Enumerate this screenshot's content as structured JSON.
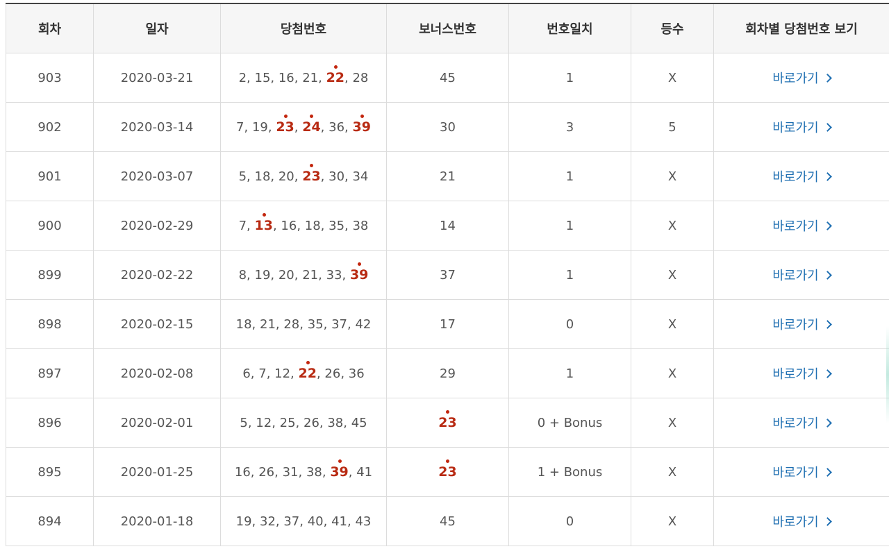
{
  "headers": [
    "회차",
    "일자",
    "당첨번호",
    "보너스번호",
    "번호일치",
    "등수",
    "회차별 당첨번호 보기"
  ],
  "link_label": "바로가기",
  "hit_color": "#b82a12",
  "link_color": "#1f6fb2",
  "rows": [
    {
      "round": "903",
      "date": "2020-03-21",
      "numbers": [
        "2",
        "15",
        "16",
        "21",
        "22",
        "28"
      ],
      "hits": [
        4
      ],
      "bonus": "45",
      "bonus_hit": false,
      "match": "1",
      "rank": "X"
    },
    {
      "round": "902",
      "date": "2020-03-14",
      "numbers": [
        "7",
        "19",
        "23",
        "24",
        "36",
        "39"
      ],
      "hits": [
        2,
        3,
        5
      ],
      "bonus": "30",
      "bonus_hit": false,
      "match": "3",
      "rank": "5"
    },
    {
      "round": "901",
      "date": "2020-03-07",
      "numbers": [
        "5",
        "18",
        "20",
        "23",
        "30",
        "34"
      ],
      "hits": [
        3
      ],
      "bonus": "21",
      "bonus_hit": false,
      "match": "1",
      "rank": "X"
    },
    {
      "round": "900",
      "date": "2020-02-29",
      "numbers": [
        "7",
        "13",
        "16",
        "18",
        "35",
        "38"
      ],
      "hits": [
        1
      ],
      "bonus": "14",
      "bonus_hit": false,
      "match": "1",
      "rank": "X"
    },
    {
      "round": "899",
      "date": "2020-02-22",
      "numbers": [
        "8",
        "19",
        "20",
        "21",
        "33",
        "39"
      ],
      "hits": [
        5
      ],
      "bonus": "37",
      "bonus_hit": false,
      "match": "1",
      "rank": "X"
    },
    {
      "round": "898",
      "date": "2020-02-15",
      "numbers": [
        "18",
        "21",
        "28",
        "35",
        "37",
        "42"
      ],
      "hits": [],
      "bonus": "17",
      "bonus_hit": false,
      "match": "0",
      "rank": "X"
    },
    {
      "round": "897",
      "date": "2020-02-08",
      "numbers": [
        "6",
        "7",
        "12",
        "22",
        "26",
        "36"
      ],
      "hits": [
        3
      ],
      "bonus": "29",
      "bonus_hit": false,
      "match": "1",
      "rank": "X"
    },
    {
      "round": "896",
      "date": "2020-02-01",
      "numbers": [
        "5",
        "12",
        "25",
        "26",
        "38",
        "45"
      ],
      "hits": [],
      "bonus": "23",
      "bonus_hit": true,
      "match": "0 + Bonus",
      "rank": "X"
    },
    {
      "round": "895",
      "date": "2020-01-25",
      "numbers": [
        "16",
        "26",
        "31",
        "38",
        "39",
        "41"
      ],
      "hits": [
        4
      ],
      "bonus": "23",
      "bonus_hit": true,
      "match": "1 + Bonus",
      "rank": "X"
    },
    {
      "round": "894",
      "date": "2020-01-18",
      "numbers": [
        "19",
        "32",
        "37",
        "40",
        "41",
        "43"
      ],
      "hits": [],
      "bonus": "45",
      "bonus_hit": false,
      "match": "0",
      "rank": "X"
    }
  ]
}
